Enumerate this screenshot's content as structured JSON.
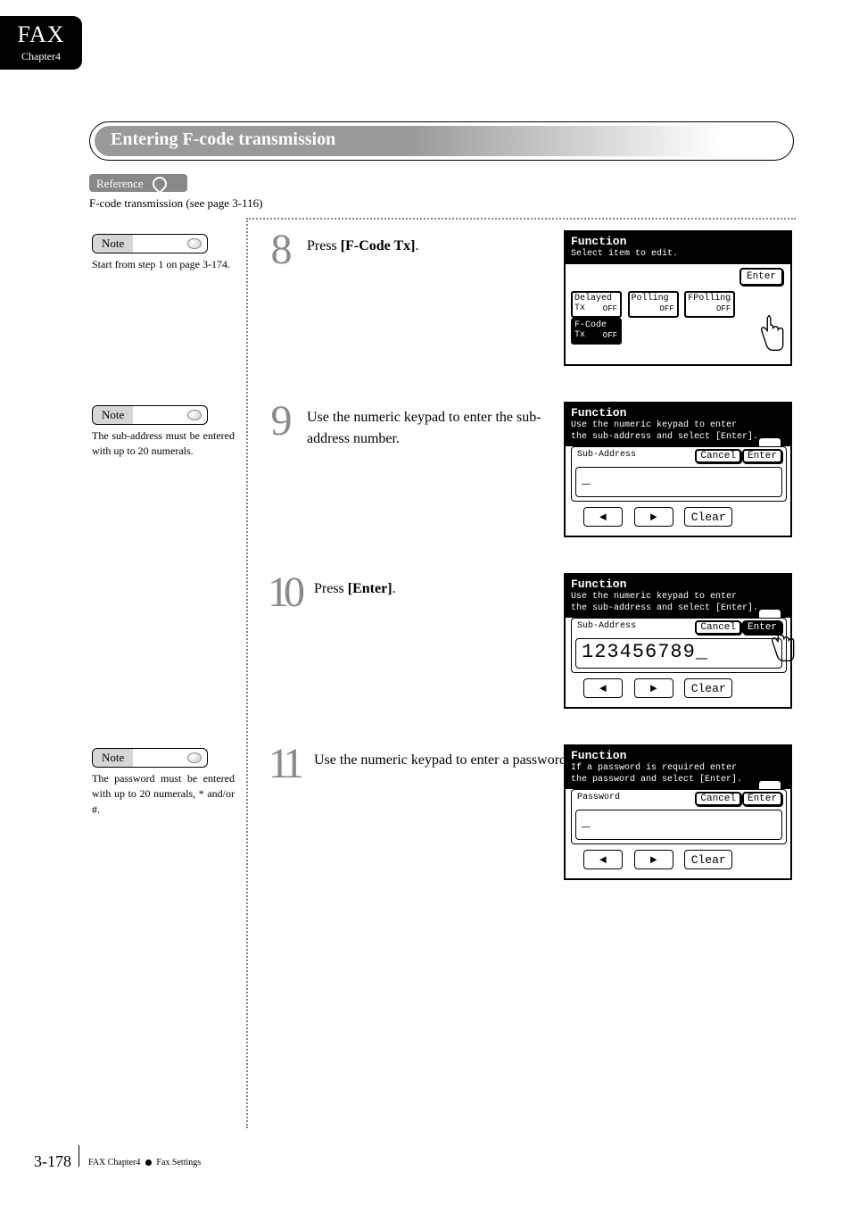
{
  "tab": {
    "title": "FAX",
    "chapter": "Chapter4"
  },
  "title": "Entering F-code transmission",
  "reference": {
    "label": "Reference",
    "text": "F-code transmission (see page 3-116)"
  },
  "notes": {
    "n1": {
      "label": "Note",
      "text": "Start from step 1 on page 3-174."
    },
    "n2": {
      "label": "Note",
      "text": "The sub-address must be entered with up to 20 numerals."
    },
    "n3": {
      "label": "Note",
      "text": "The password must be entered with up to 20 numerals, * and/or #."
    }
  },
  "steps": {
    "s8": {
      "num": "8",
      "pre": "Press ",
      "bold": "[F-Code Tx]",
      "post": "."
    },
    "s9": {
      "num": "9",
      "text": "Use the numeric keypad to enter the sub-address number."
    },
    "s10": {
      "num": "10",
      "pre": "Press ",
      "bold": "[Enter]",
      "post": "."
    },
    "s11": {
      "num": "11",
      "text": "Use the numeric keypad to enter a password."
    }
  },
  "screens": {
    "a": {
      "title": "Function",
      "sub": "Select item to edit.",
      "enter": "Enter",
      "tiles": {
        "t1": {
          "lbl": "Delayed Tx",
          "st": "OFF"
        },
        "t2": {
          "lbl": "Polling",
          "st": "OFF"
        },
        "t3": {
          "lbl": "FPolling",
          "st": "OFF"
        },
        "t4": {
          "lbl": "F-Code Tx",
          "st": "OFF"
        }
      }
    },
    "b": {
      "title": "Function",
      "sub1": "Use the numeric keypad to enter",
      "sub2": "the sub-address and select [Enter].",
      "field": "Sub-Address",
      "value": "_",
      "cancel": "Cancel",
      "enter": "Enter",
      "clear": "Clear"
    },
    "c": {
      "title": "Function",
      "sub1": "Use the numeric keypad to enter",
      "sub2": "the sub-address and select [Enter].",
      "field": "Sub-Address",
      "value": "123456789_",
      "cancel": "Cancel",
      "enter": "Enter",
      "clear": "Clear"
    },
    "d": {
      "title": "Function",
      "sub1": "If a password is required enter",
      "sub2": "the password and select [Enter].",
      "field": "Password",
      "value": "_",
      "cancel": "Cancel",
      "enter": "Enter",
      "clear": "Clear"
    }
  },
  "footer": {
    "page": "3-178",
    "left": "FAX Chapter4",
    "right": "Fax Settings"
  }
}
